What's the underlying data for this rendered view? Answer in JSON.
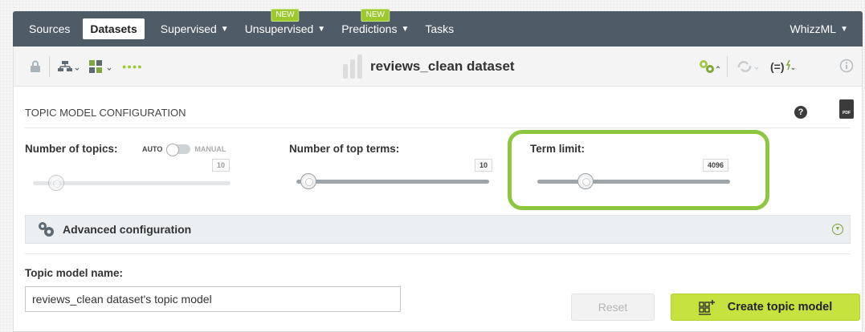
{
  "nav": {
    "items": [
      {
        "label": "Sources",
        "badge": ""
      },
      {
        "label": "Datasets",
        "badge": ""
      },
      {
        "label": "Supervised",
        "badge": ""
      },
      {
        "label": "Unsupervised",
        "badge": "NEW"
      },
      {
        "label": "Predictions",
        "badge": "NEW"
      },
      {
        "label": "Tasks",
        "badge": ""
      }
    ],
    "right_label": "WhizzML"
  },
  "toolbar": {
    "dataset_title": "reviews_clean dataset",
    "dots": "●●●●"
  },
  "config": {
    "heading": "TOPIC MODEL CONFIGURATION",
    "help_symbol": "?",
    "pdf_label": "PDF",
    "number_of_topics": {
      "label": "Number of topics:",
      "toggle_auto": "AUTO",
      "toggle_manual": "MANUAL",
      "value": "10",
      "slider_fraction": 0.12
    },
    "number_of_top_terms": {
      "label": "Number of top terms:",
      "value": "10",
      "slider_fraction": 0.07
    },
    "term_limit": {
      "label": "Term limit:",
      "value": "4096",
      "slider_fraction": 0.25
    },
    "advanced_label": "Advanced configuration",
    "name_label": "Topic model name:",
    "name_value": "reviews_clean dataset's topic model",
    "reset_label": "Reset",
    "create_label": "Create topic model"
  },
  "colors": {
    "nav_bg": "#4f5b66",
    "highlight": "#8dc63f",
    "create_btn": "#c5e23e",
    "badge": "#9cc92e"
  }
}
